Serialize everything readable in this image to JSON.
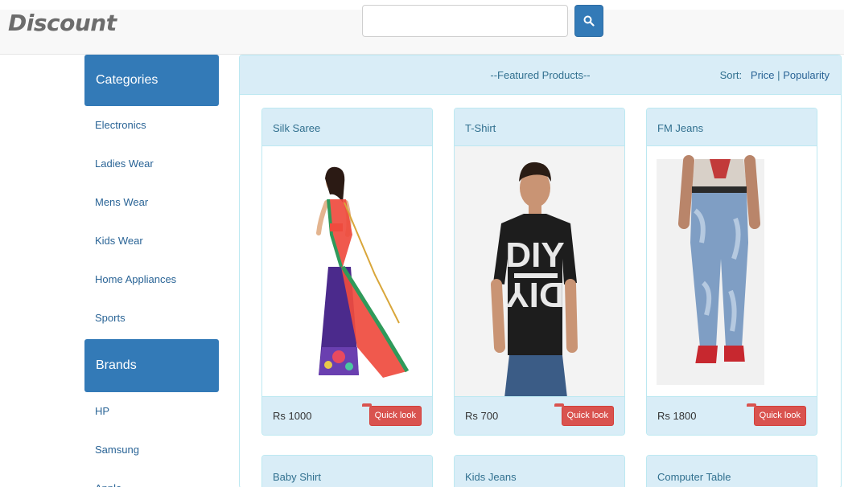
{
  "header": {
    "brand": "Discount",
    "search_placeholder": ""
  },
  "sidebar": {
    "categories_heading": "Categories",
    "categories": [
      "Electronics",
      "Ladies Wear",
      "Mens Wear",
      "Kids Wear",
      "Home Appliances",
      "Sports"
    ],
    "brands_heading": "Brands",
    "brands": [
      "HP",
      "Samsung",
      "Apple"
    ]
  },
  "main": {
    "title": "--Featured Products--",
    "sort_label": "Sort:",
    "sort_price": "Price",
    "sort_separator": "|",
    "sort_popularity": "Popularity",
    "quick_look_label": "Quick look",
    "products": [
      {
        "name": "Silk Saree",
        "price": "Rs 1000"
      },
      {
        "name": "T-Shirt",
        "price": "Rs 700"
      },
      {
        "name": "FM Jeans",
        "price": "Rs 1800"
      }
    ],
    "more_products": [
      {
        "name": "Baby Shirt"
      },
      {
        "name": "Kids Jeans"
      },
      {
        "name": "Computer Table"
      }
    ]
  },
  "colors": {
    "primary": "#337ab7",
    "panel_bg": "#d9edf7",
    "danger": "#d9534f"
  }
}
